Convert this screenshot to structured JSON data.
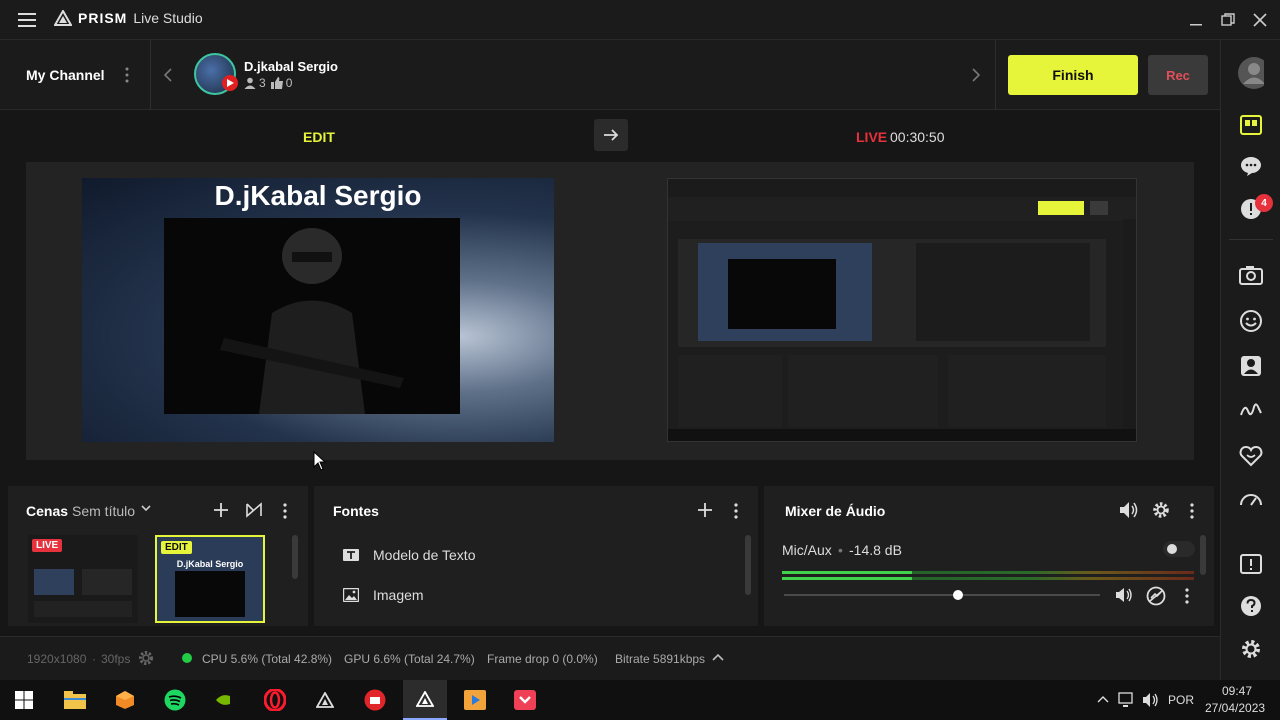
{
  "app": {
    "brand_strong": "PRISM",
    "brand_light": "Live Studio"
  },
  "channel": {
    "my_channel": "My Channel",
    "name": "D.jkabal Sergio",
    "viewers": "3",
    "likes": "0",
    "platform_icon": "youtube-icon"
  },
  "controls": {
    "finish_label": "Finish",
    "rec_label": "Rec"
  },
  "notifications": {
    "count": "4"
  },
  "preview": {
    "edit_label": "EDIT",
    "live_label": "LIVE",
    "live_time": "00:30:50",
    "scene_title": "D.jKabal Sergio"
  },
  "scenes": {
    "title": "Cenas",
    "scene_name": "Sem título",
    "live_badge": "LIVE",
    "edit_badge": "EDIT",
    "thumb_title": "D.jKabal Sergio"
  },
  "sources": {
    "title": "Fontes",
    "items": [
      {
        "label": "Modelo de Texto",
        "icon": "text-template-icon"
      },
      {
        "label": "Imagem",
        "icon": "image-icon"
      }
    ]
  },
  "mixer": {
    "title": "Mixer de Áudio",
    "channel_name": "Mic/Aux",
    "level": "-14.8 dB",
    "volume_fraction": 0.55
  },
  "status": {
    "resolution": "1920x1080",
    "fps": "30fps",
    "cpu": "CPU 5.6% (Total 42.8%)",
    "gpu": "GPU 6.6% (Total 24.7%)",
    "frame_drop": "Frame drop 0 (0.0%)",
    "bitrate": "Bitrate 5891kbps"
  },
  "taskbar": {
    "time": "09:47",
    "date": "27/04/2023",
    "language": "POR"
  },
  "colors": {
    "accent": "#e6f53a",
    "live": "#e5323c",
    "status_ok": "#22cc44"
  }
}
